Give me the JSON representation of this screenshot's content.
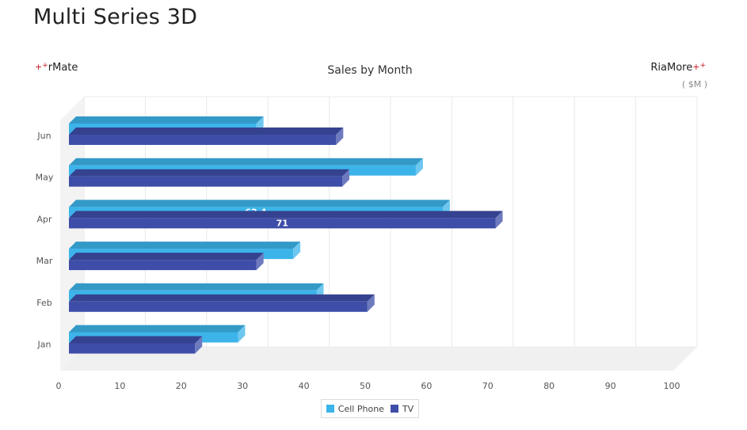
{
  "page": {
    "title": "Multi Series 3D"
  },
  "brand": {
    "left_name": "rMate",
    "left_mark": "+",
    "right_name": "RiaMore",
    "right_mark": "+"
  },
  "chart_data": {
    "type": "bar",
    "orientation": "horizontal",
    "title": "Sales by Month",
    "unit": "( $M )",
    "categories": [
      "Jan",
      "Feb",
      "Mar",
      "Apr",
      "May",
      "Jun"
    ],
    "series": [
      {
        "name": "Cell Phone",
        "values": [
          29,
          41.8,
          38,
          62.4,
          58,
          32
        ],
        "color": "#3cb4ea"
      },
      {
        "name": "TV",
        "values": [
          22,
          50.1,
          32,
          71,
          46,
          45
        ],
        "color": "#3e4ea8"
      }
    ],
    "data_labels": [
      {
        "series": 0,
        "category": "Apr",
        "text": "62.4"
      },
      {
        "series": 1,
        "category": "Apr",
        "text": "71"
      }
    ],
    "xlim": [
      0,
      100
    ],
    "x_ticks": [
      "0",
      "10",
      "20",
      "30",
      "40",
      "50",
      "60",
      "70",
      "80",
      "90",
      "100"
    ],
    "grid": true,
    "legend_position": "bottom"
  }
}
